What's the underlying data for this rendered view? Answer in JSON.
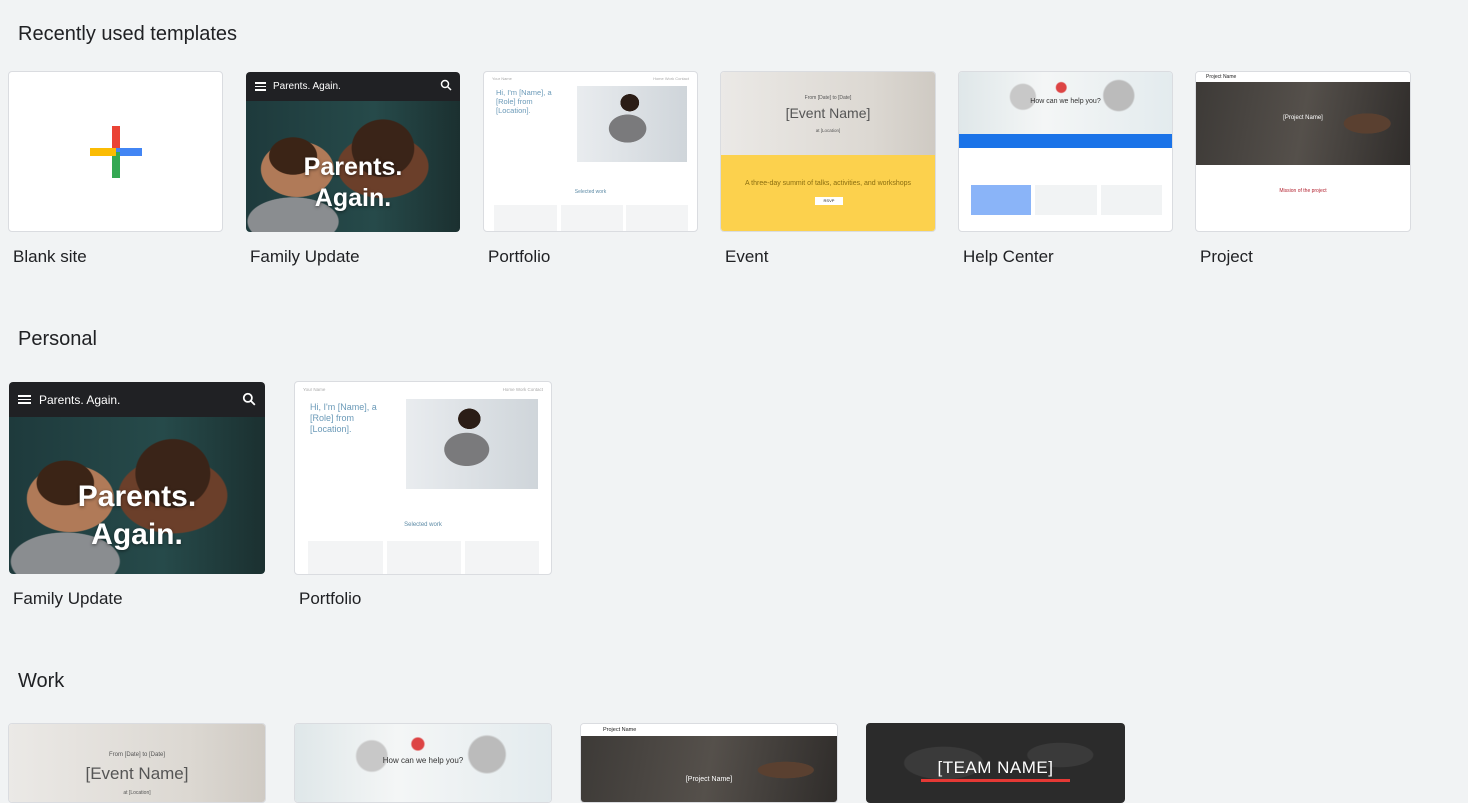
{
  "sections": {
    "recent": "Recently used templates",
    "personal": "Personal",
    "work": "Work"
  },
  "templates": {
    "blank": "Blank site",
    "family": "Family Update",
    "portfolio": "Portfolio",
    "event": "Event",
    "help": "Help Center",
    "project": "Project"
  },
  "family_thumb": {
    "header": "Parents. Again.",
    "line1": "Parents.",
    "line2": "Again."
  },
  "portfolio_thumb": {
    "site": "Your Name",
    "nav": "Home  Work  Contact",
    "intro": "Hi, I'm [Name], a [Role] from [Location].",
    "selected": "Selected work"
  },
  "event_thumb": {
    "dates": "From [Date] to [Date]",
    "name": "[Event Name]",
    "location": "at [Location]",
    "tagline": "A three-day summit of talks, activities, and workshops",
    "button": "RSVP"
  },
  "help_thumb": {
    "question": "How can we help you?"
  },
  "project_thumb": {
    "bar": "Project Name",
    "name": "[Project Name]",
    "mission": "Mission of the project"
  },
  "team_thumb": {
    "name": "[TEAM NAME]"
  },
  "colors": {
    "background": "#f1f3f4",
    "plus_blue": "#4285f4",
    "plus_red": "#ea4335",
    "plus_yellow": "#fbbc04",
    "plus_green": "#34a853",
    "event_yellow": "#fcd14d",
    "help_blue": "#1a73e8",
    "team_red": "#e53935"
  }
}
